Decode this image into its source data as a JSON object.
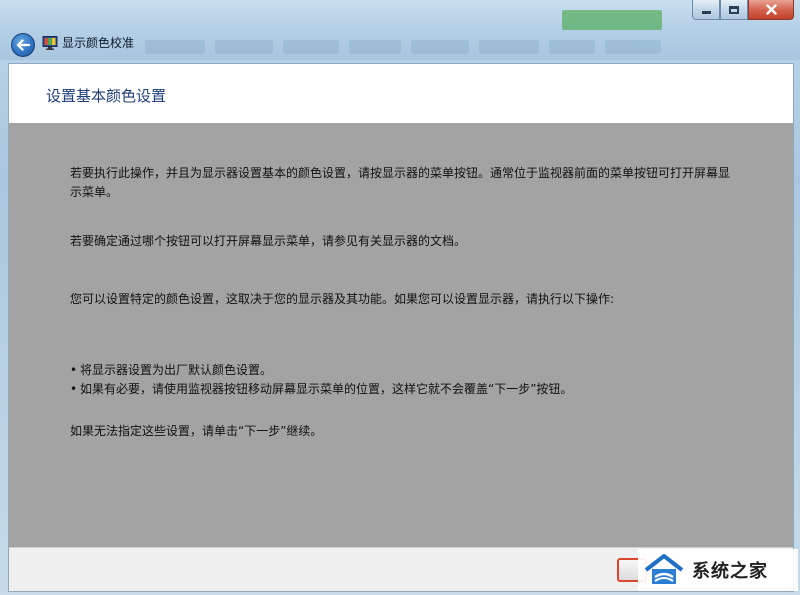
{
  "window": {
    "title": "显示颜色校准"
  },
  "page": {
    "title": "设置基本颜色设置",
    "paragraphs": [
      "若要执行此操作，并且为显示器设置基本的颜色设置，请按显示器的菜单按钮。通常位于监视器前面的菜单按钮可打开屏幕显示菜单。",
      "若要确定通过哪个按钮可以打开屏幕显示菜单，请参见有关显示器的文档。",
      "您可以设置特定的颜色设置，这取决于您的显示器及其功能。如果您可以设置显示器，请执行以下操作:"
    ],
    "bullets": [
      "将显示器设置为出厂默认颜色设置。",
      "如果有必要，请使用监视器按钮移动屏幕显示菜单的位置，这样它就不会覆盖“下一步”按钮。"
    ],
    "closing": "如果无法指定这些设置，请单击“下一步”继续。"
  },
  "watermark": {
    "text": "系统之家"
  },
  "icons": {
    "back": "back-arrow-icon",
    "app": "monitor-color-icon",
    "minimize": "minimize-icon",
    "maximize": "maximize-icon",
    "close": "close-icon"
  },
  "colors": {
    "title_blue": "#1e3e7a",
    "gray_overlay": "#a3a3a3",
    "close_red": "#c2402a",
    "highlight_red": "#d9452e"
  }
}
